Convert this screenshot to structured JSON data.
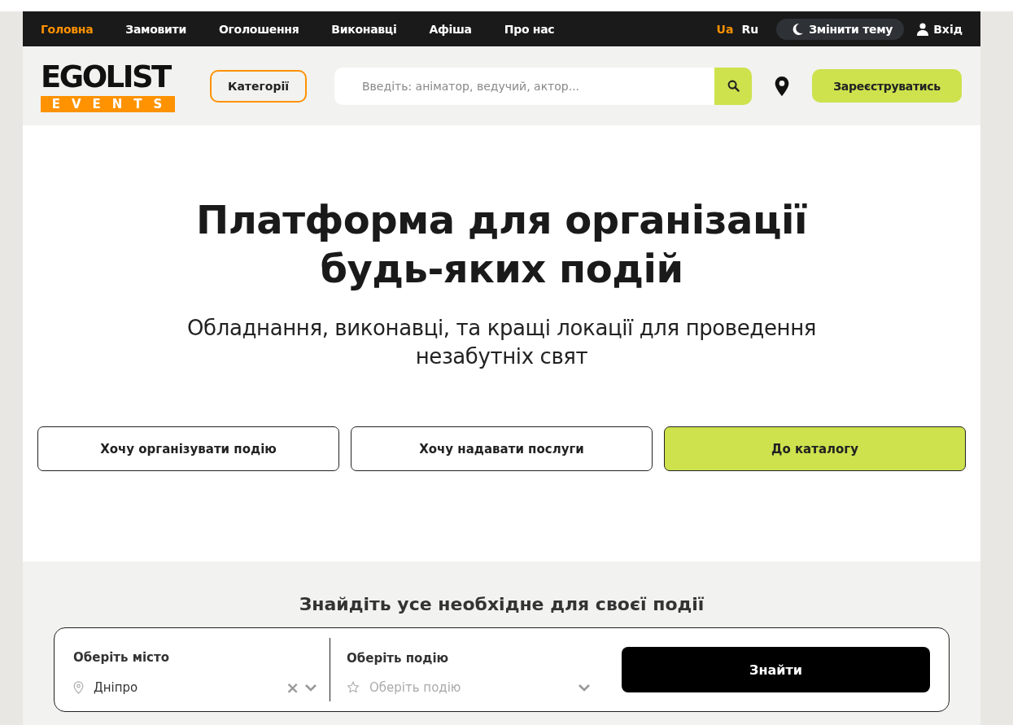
{
  "nav": [
    {
      "label": "Головна",
      "selected": true
    },
    {
      "label": "Замовити",
      "selected": false
    },
    {
      "label": "Оголошення",
      "selected": false
    },
    {
      "label": "Виконавці",
      "selected": false
    },
    {
      "label": "Афіша",
      "selected": false
    },
    {
      "label": "Про нас",
      "selected": false
    }
  ],
  "languages": [
    {
      "label": "Ua",
      "selected": true
    },
    {
      "label": "Ru",
      "selected": false
    }
  ],
  "theme_button": "Змінити тему",
  "login": "Вхід",
  "logo": {
    "top": "EGOLIST",
    "bottom": "EVENTS"
  },
  "categories_button": "Категорії",
  "search": {
    "placeholder": "Введіть: аніматор, ведучий, актор..."
  },
  "register_button": "Зареєструватись",
  "hero": {
    "title": "Платформа для організації будь-яких подій",
    "subtitle": "Обладнання, виконавці, та кращі локації для проведення незабутніх свят"
  },
  "actions": [
    {
      "label": "Хочу організувати подію",
      "kind": "outline"
    },
    {
      "label": "Хочу надавати послуги",
      "kind": "outline"
    },
    {
      "label": "До каталогу",
      "kind": "primary"
    }
  ],
  "finder": {
    "title": "Знайдіть усе необхідне для своєї події",
    "city": {
      "label": "Оберіть місто",
      "value": "Дніпро",
      "clear": "×"
    },
    "event": {
      "label": "Оберіть подію",
      "placeholder": "Оберіть подію"
    },
    "button": "Знайти"
  }
}
